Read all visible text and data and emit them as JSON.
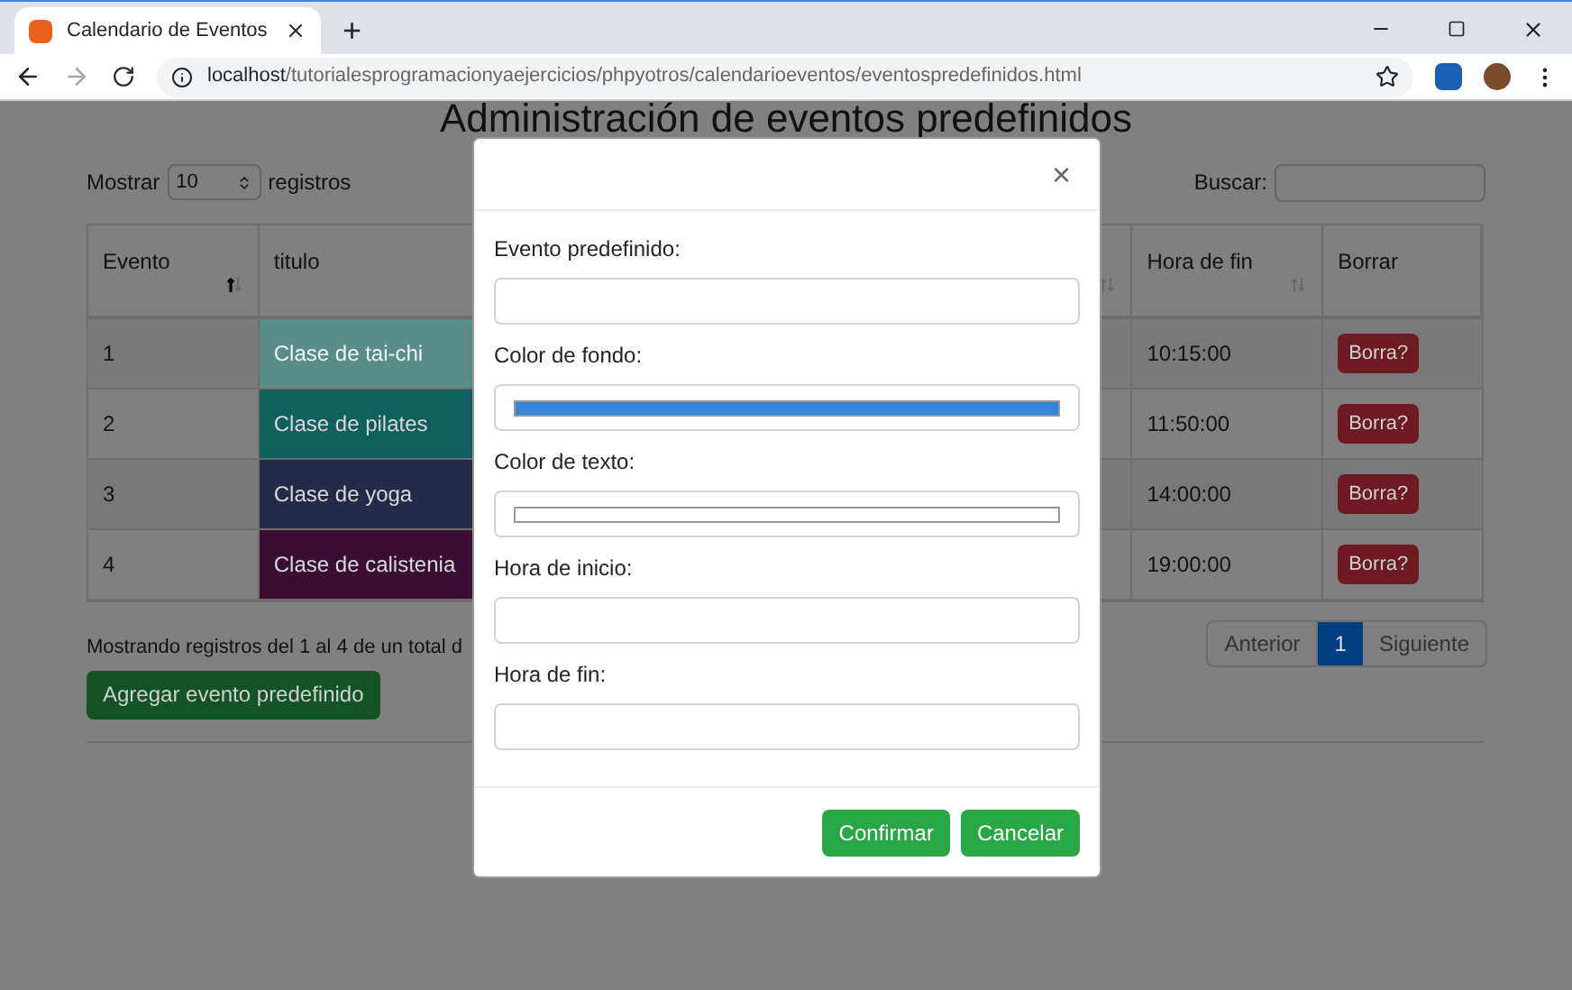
{
  "browser": {
    "tab_title": "Calendario de Eventos",
    "new_tab": "+",
    "url_host": "localhost",
    "url_path": "/tutorialesprogramacionyaejercicios/phpyotros/calendarioeventos/eventospredefinidos.html"
  },
  "page": {
    "heading": "Administración de eventos predefinidos",
    "show_label": "Mostrar",
    "page_size": "10",
    "show_suffix": "registros",
    "search_label": "Buscar:",
    "table": {
      "columns": [
        {
          "label": "Evento",
          "kind": "sortable",
          "sorted": true
        },
        {
          "label": "titulo",
          "kind": "plain"
        },
        {
          "kind": "sortable",
          "sorted": false
        },
        {
          "label": "Hora de fin",
          "kind": "sortable",
          "sorted": false
        },
        {
          "label": "Borrar",
          "kind": "plain"
        }
      ],
      "rows": [
        {
          "evento": "1",
          "titulo": "Clase de tai-chi",
          "color": "#5a8c88",
          "hora_fin": "10:15:00",
          "delete": "Borra?"
        },
        {
          "evento": "2",
          "titulo": "Clase de pilates",
          "color": "#0f5f5c",
          "hora_fin": "11:50:00",
          "delete": "Borra?"
        },
        {
          "evento": "3",
          "titulo": "Clase de yoga",
          "color": "#252a4a",
          "hora_fin": "14:00:00",
          "delete": "Borra?"
        },
        {
          "evento": "4",
          "titulo": "Clase de calistenia",
          "color": "#3a0e34",
          "hora_fin": "19:00:00",
          "delete": "Borra?"
        }
      ]
    },
    "info": "Mostrando registros del 1 al 4 de un total d",
    "add_button": "Agregar evento predefinido",
    "pagination": {
      "previous": "Anterior",
      "pages": [
        {
          "label": "1",
          "selected": true
        }
      ],
      "next": "Siguiente"
    }
  },
  "modal": {
    "close": "×",
    "fields": [
      {
        "label": "Evento predefinido:",
        "kind": "text"
      },
      {
        "label": "Color de fondo:",
        "kind": "color",
        "color": "#3584d8"
      },
      {
        "label": "Color de texto:",
        "kind": "color",
        "color": "#ffffff"
      },
      {
        "label": "Hora de inicio:",
        "kind": "text"
      },
      {
        "label": "Hora de fin:",
        "kind": "text"
      }
    ],
    "buttons": [
      "Confirmar",
      "Cancelar"
    ]
  }
}
